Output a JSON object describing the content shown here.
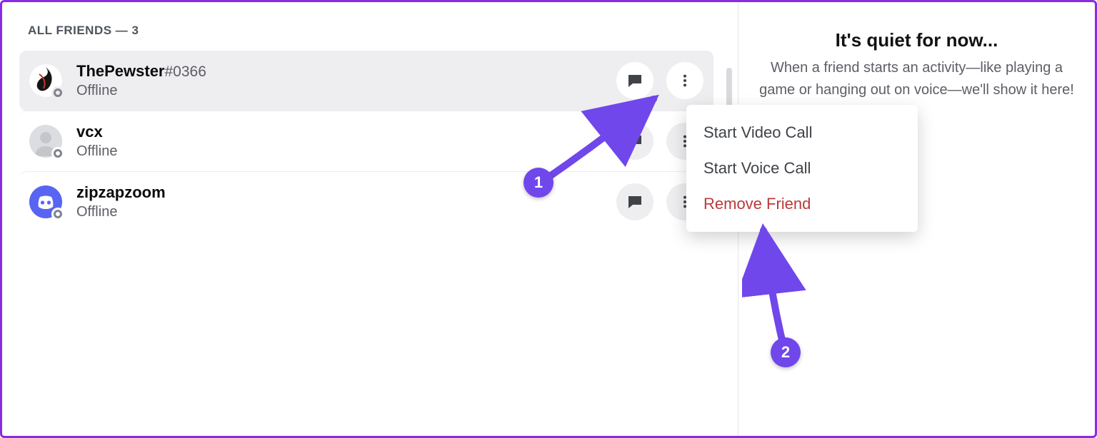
{
  "header": {
    "label": "ALL FRIENDS — 3"
  },
  "friends": [
    {
      "name": "ThePewster",
      "tag": "#0366",
      "status": "Offline",
      "hovered": true,
      "avatar": "custom"
    },
    {
      "name": "vcx",
      "tag": "",
      "status": "Offline",
      "hovered": false,
      "avatar": "default"
    },
    {
      "name": "zipzapzoom",
      "tag": "",
      "status": "Offline",
      "hovered": false,
      "avatar": "discord"
    }
  ],
  "context_menu": {
    "items": [
      {
        "label": "Start Video Call",
        "danger": false
      },
      {
        "label": "Start Voice Call",
        "danger": false
      },
      {
        "label": "Remove Friend",
        "danger": true
      }
    ]
  },
  "right_panel": {
    "title": "It's quiet for now...",
    "subtitle": "When a friend starts an activity—like playing a game or hanging out on voice—we'll show it here!"
  },
  "annotations": {
    "badge1": "1",
    "badge2": "2"
  }
}
